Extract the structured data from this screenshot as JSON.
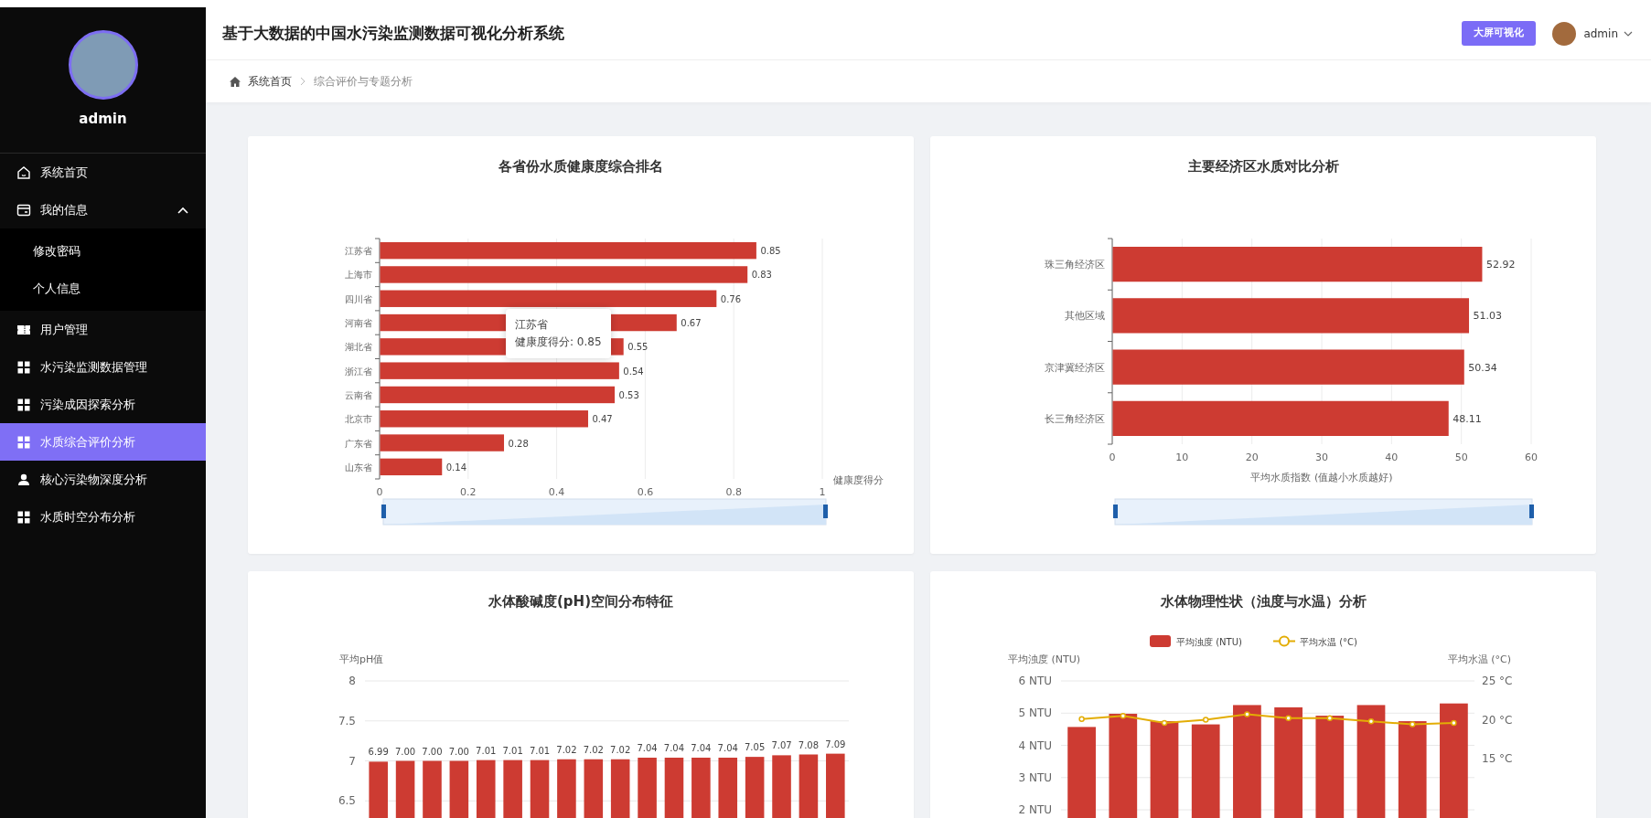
{
  "header": {
    "title": "基于大数据的中国水污染监测数据可视化分析系统",
    "big_screen_button": "大屏可视化",
    "user": "admin"
  },
  "breadcrumb": [
    "系统首页",
    "综合评价与专题分析"
  ],
  "sidebar": {
    "user": "admin",
    "items": [
      {
        "label": "系统首页",
        "kind": "home",
        "selected": false
      },
      {
        "label": "我的信息",
        "kind": "profile",
        "selected": false,
        "expanded": true,
        "children": [
          {
            "label": "修改密码",
            "selected": false
          },
          {
            "label": "个人信息",
            "selected": false
          }
        ]
      },
      {
        "label": "用户管理",
        "kind": "users",
        "selected": false
      },
      {
        "label": "水污染监测数据管理",
        "kind": "module",
        "selected": false
      },
      {
        "label": "污染成因探索分析",
        "kind": "module",
        "selected": false
      },
      {
        "label": "水质综合评价分析",
        "kind": "module",
        "selected": true
      },
      {
        "label": "核心污染物深度分析",
        "kind": "person",
        "selected": false
      },
      {
        "label": "水质时空分布分析",
        "kind": "module",
        "selected": false
      }
    ]
  },
  "cards": [
    {
      "title": "各省份水质健康度综合排名",
      "tooltip": {
        "title": "江苏省",
        "text": "健康度得分: 0.85"
      },
      "chart_data": {
        "type": "bar",
        "orientation": "horizontal",
        "xlabel": "健康度得分",
        "categories": [
          "江苏省",
          "上海市",
          "四川省",
          "河南省",
          "湖北省",
          "浙江省",
          "云南省",
          "北京市",
          "广东省",
          "山东省"
        ],
        "grid": true,
        "series": [
          {
            "color": "#cd3b32",
            "values": [
              0.85,
              0.83,
              0.76,
              0.67,
              0.55,
              0.54,
              0.53,
              0.47,
              0.28,
              0.14
            ]
          }
        ],
        "xlim": [
          0,
          1
        ],
        "xticks": [
          0,
          0.2,
          0.4,
          0.6,
          0.8,
          1
        ],
        "data_labels": true
      }
    },
    {
      "title": "主要经济区水质对比分析",
      "chart_data": {
        "type": "bar",
        "orientation": "horizontal",
        "xlabel": "平均水质指数 (值越小水质越好)",
        "categories": [
          "珠三角经济区",
          "其他区域",
          "京津冀经济区",
          "长三角经济区"
        ],
        "grid": true,
        "series": [
          {
            "color": "#cd3b32",
            "values": [
              52.92,
              51.03,
              50.34,
              48.11
            ]
          }
        ],
        "xlim": [
          0,
          60
        ],
        "xticks": [
          0,
          10,
          20,
          30,
          40,
          50,
          60
        ],
        "data_labels": true
      }
    },
    {
      "title": "水体酸碱度(pH)空间分布特征",
      "chart_data": {
        "type": "bar",
        "ylabel": "平均pH值",
        "grid": true,
        "series": [
          {
            "color": "#cd3b32",
            "values": [
              6.99,
              7.0,
              7.0,
              7.0,
              7.01,
              7.01,
              7.01,
              7.02,
              7.02,
              7.02,
              7.04,
              7.04,
              7.04,
              7.04,
              7.05,
              7.07,
              7.08,
              7.09
            ]
          }
        ],
        "value_labels": [
          "6.99",
          "7.00",
          "7.00",
          "7.00",
          "7.01",
          "7.01",
          "7.01",
          "7.02",
          "7.02",
          "7.02",
          "7.04",
          "7.04",
          "7.04",
          "7.04",
          "7.05",
          "7.07",
          "7.08",
          "7.09"
        ],
        "ylim": [
          6,
          8
        ],
        "yticks": [
          {
            "value": 6.5,
            "label": "6.5"
          },
          {
            "value": 7,
            "label": "7"
          },
          {
            "value": 7.5,
            "label": "7.5"
          },
          {
            "value": 8,
            "label": "8"
          }
        ]
      }
    },
    {
      "title": "水体物理性状（浊度与水温）分析",
      "layers": [
        {
          "chart_data": {
            "type": "bar",
            "ylabel": "平均浊度 (NTU)",
            "legend": "top",
            "grid": true,
            "series": [
              {
                "name": "平均浊度 (NTU)",
                "color": "#cd3b32",
                "values": [
                  4.57,
                  4.98,
                  4.75,
                  4.65,
                  5.25,
                  5.18,
                  4.92,
                  5.25,
                  4.75,
                  5.3
                ]
              }
            ],
            "ylim": [
              0,
              6
            ],
            "yticks": [
              {
                "value": 2,
                "label": "2 NTU"
              },
              {
                "value": 3,
                "label": "3 NTU"
              },
              {
                "value": 4,
                "label": "4 NTU"
              },
              {
                "value": 5,
                "label": "5 NTU"
              },
              {
                "value": 6,
                "label": "6 NTU"
              }
            ]
          }
        },
        {
          "chart_data": {
            "type": "line",
            "ylabel": "平均水温 (°C)",
            "legend": "top",
            "series": [
              {
                "name": "平均水温 (°C)",
                "color": "#e3ad05",
                "marker": "circle",
                "values": [
                  20.1,
                  20.5,
                  19.6,
                  20.0,
                  20.7,
                  20.2,
                  20.2,
                  19.8,
                  19.4,
                  19.6
                ]
              }
            ],
            "ylim": [
              15,
              25
            ],
            "yticks": [
              {
                "value": 15,
                "label": "15 °C"
              },
              {
                "value": 20,
                "label": "20 °C"
              },
              {
                "value": 25,
                "label": "25 °C"
              }
            ]
          }
        }
      ]
    }
  ]
}
